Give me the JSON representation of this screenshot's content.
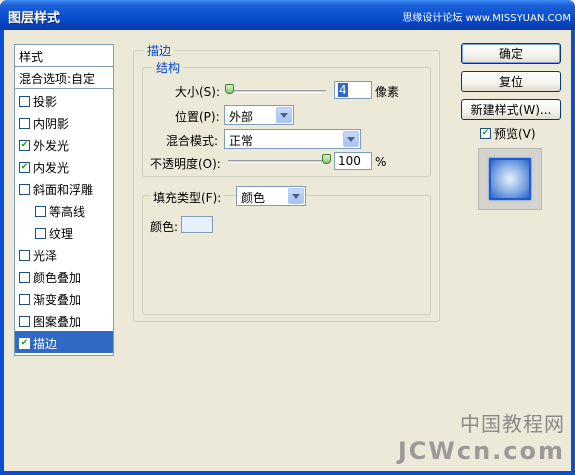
{
  "window": {
    "title": "图层样式",
    "watermark": "思缘设计论坛 www.MISSYUAN.COM"
  },
  "styles": {
    "header": "样式",
    "blend_options": "混合选项:自定",
    "items": [
      {
        "label": "投影",
        "checked": false,
        "indent": false,
        "selected": false
      },
      {
        "label": "内阴影",
        "checked": false,
        "indent": false,
        "selected": false
      },
      {
        "label": "外发光",
        "checked": true,
        "indent": false,
        "selected": false
      },
      {
        "label": "内发光",
        "checked": true,
        "indent": false,
        "selected": false
      },
      {
        "label": "斜面和浮雕",
        "checked": false,
        "indent": false,
        "selected": false
      },
      {
        "label": "等高线",
        "checked": false,
        "indent": true,
        "selected": false
      },
      {
        "label": "纹理",
        "checked": false,
        "indent": true,
        "selected": false
      },
      {
        "label": "光泽",
        "checked": false,
        "indent": false,
        "selected": false
      },
      {
        "label": "颜色叠加",
        "checked": false,
        "indent": false,
        "selected": false
      },
      {
        "label": "渐变叠加",
        "checked": false,
        "indent": false,
        "selected": false
      },
      {
        "label": "图案叠加",
        "checked": false,
        "indent": false,
        "selected": false
      },
      {
        "label": "描边",
        "checked": true,
        "indent": false,
        "selected": true
      }
    ]
  },
  "stroke": {
    "title": "描边",
    "structure_title": "结构",
    "size_label": "大小(S):",
    "size_value": "4",
    "size_unit": "像素",
    "position_label": "位置(P):",
    "position_value": "外部",
    "blend_mode_label": "混合模式:",
    "blend_mode_value": "正常",
    "opacity_label": "不透明度(O):",
    "opacity_value": "100",
    "opacity_unit": "%",
    "fill_type_label": "填充类型(F):",
    "fill_type_value": "颜色",
    "color_label": "颜色:",
    "color_value": "#e6f0fc"
  },
  "buttons": {
    "ok": "确定",
    "reset": "复位",
    "new_style": "新建样式(W)...",
    "preview_label": "预览(V)",
    "preview_checked": true
  },
  "corner_watermark": {
    "cn": "中国教程网",
    "en": "JCWcn.com"
  }
}
